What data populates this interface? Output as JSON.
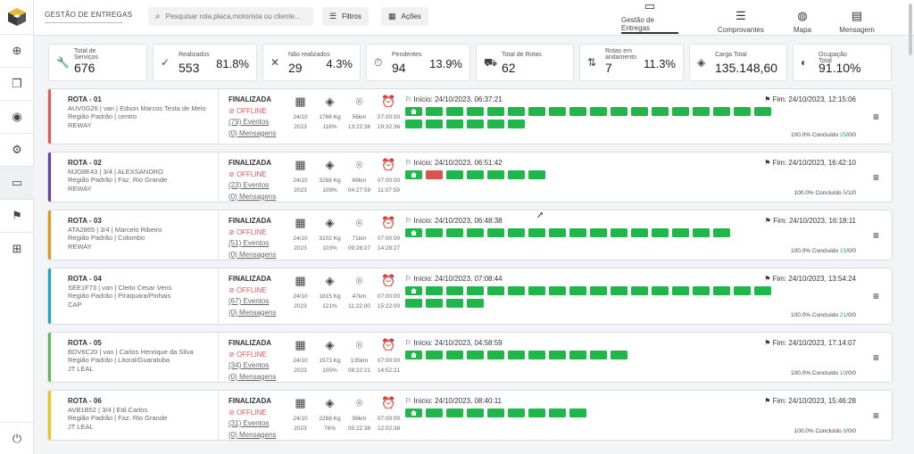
{
  "sidebar": {
    "items": [
      {
        "name": "plus-circle-icon",
        "glyph": "⊕"
      },
      {
        "name": "copy-icon",
        "glyph": "❐"
      },
      {
        "name": "user-circle-icon",
        "glyph": "◉"
      },
      {
        "name": "gear-icon",
        "glyph": "⚙"
      },
      {
        "name": "laptop-icon",
        "glyph": "▭"
      },
      {
        "name": "route-icon",
        "glyph": "⚑"
      },
      {
        "name": "sitemap-icon",
        "glyph": "⊞"
      }
    ],
    "power_glyph": "⏻"
  },
  "header": {
    "title": "GESTÃO DE ENTREGAS",
    "search_placeholder": "Pesquisar rota,placa,motorista ou cliente...",
    "filters_label": "Filtros",
    "actions_label": "Ações",
    "nav": [
      {
        "label": "Gestão de Entregas",
        "icon": "laptop-icon",
        "glyph": "▭"
      },
      {
        "label": "Comprovantes",
        "icon": "checklist-icon",
        "glyph": "☰"
      },
      {
        "label": "Mapa",
        "icon": "globe-icon",
        "glyph": "◍"
      },
      {
        "label": "Mensagem",
        "icon": "message-icon",
        "glyph": "▤"
      }
    ]
  },
  "stats": [
    {
      "label": "Total de Serviços",
      "value": "676",
      "pct": "",
      "icon": "wrench-icon",
      "glyph": "🔧",
      "w": 111
    },
    {
      "label": "Realizados",
      "value": "553",
      "pct": "81.8%",
      "icon": "check-circle-icon",
      "glyph": "✓",
      "w": 117
    },
    {
      "label": "Não realizados",
      "value": "29",
      "pct": "4.3%",
      "icon": "x-circle-icon",
      "glyph": "✕",
      "w": 110
    },
    {
      "label": "Pendentes",
      "value": "94",
      "pct": "13.9%",
      "icon": "stopwatch-icon",
      "glyph": "⏱",
      "w": 117
    },
    {
      "label": "Total de Rotas",
      "value": "62",
      "pct": "",
      "icon": "truck-icon",
      "glyph": "⛟",
      "w": 110
    },
    {
      "label": "Rotas em andamento",
      "value": "7",
      "pct": "11.3%",
      "icon": "arrows-icon",
      "glyph": "⇅",
      "w": 117
    },
    {
      "label": "Carga Total",
      "value": "135.148,60",
      "pct": "",
      "icon": "layers-icon",
      "glyph": "◈",
      "w": 110
    },
    {
      "label": "Ocupação Total",
      "value": "91.10%",
      "pct": "",
      "icon": "gauge-icon",
      "glyph": "◐",
      "w": 111
    }
  ],
  "routes": [
    {
      "name": "ROTA - 01",
      "vehicle": "AUV0G26 | van | Edson Marcos Testa de Melo",
      "region": "Região Padrão | centro",
      "company": "REWAY",
      "color": "#e05a5a",
      "status": "FINALIZADA",
      "offline": "OFFLINE",
      "events": "(79) Eventos",
      "messages": "(0) Mensagens",
      "date": "24/10",
      "year": "2023",
      "weight": "1766 Kg",
      "occupancy": "118%",
      "distance": "56km",
      "time": "13:22:36",
      "window": "07:00:00",
      "window2": "19:32:36",
      "start": "Início: 24/10/2023, 06:37:21",
      "end": "Fim: 24/10/2023, 12:15:06",
      "chips": [
        "home",
        "g",
        "g",
        "g",
        "g",
        "g",
        "g",
        "g",
        "g",
        "g",
        "g",
        "g",
        "g",
        "g",
        "g",
        "g",
        "g",
        "g",
        "g",
        "g",
        "g",
        "g",
        "g",
        "g"
      ],
      "summary_prefix": "100.0% Concluído ",
      "done": "25",
      "tail": "/0/0",
      "height": 63
    },
    {
      "name": "ROTA - 02",
      "vehicle": "MJO8E43 | 3/4 | ALEXSANDRO",
      "region": "Região Padrão | Faz. Rio Grande",
      "company": "REWAY",
      "color": "#6a3db8",
      "status": "FINALIZADA",
      "offline": "OFFLINE",
      "events": "(23) Eventos",
      "messages": "(0) Mensagens",
      "date": "24/10",
      "year": "2023",
      "weight": "3268 Kg",
      "occupancy": "109%",
      "distance": "69km",
      "time": "04:27:59",
      "window": "07:00:00",
      "window2": "11:07:59",
      "start": "Início: 24/10/2023, 06:51:42",
      "end": "Fim: 24/10/2023, 16:42:10",
      "chips": [
        "home",
        "red",
        "g",
        "g",
        "g",
        "g",
        "g"
      ],
      "summary_prefix": "100.0% Concluído ",
      "done": "5",
      "tail": "/1/0",
      "height": 57
    },
    {
      "name": "ROTA - 03",
      "vehicle": "ATA2865 | 3/4 | Marcelo Ribeiro",
      "region": "Região Padrão | Colombo",
      "company": "REWAY",
      "color": "#e8951c",
      "status": "FINALIZADA",
      "offline": "OFFLINE",
      "events": "(51) Eventos",
      "messages": "(0) Mensagens",
      "date": "24/10",
      "year": "2023",
      "weight": "3102 Kg",
      "occupancy": "103%",
      "distance": "71km",
      "time": "09:28:27",
      "window": "07:00:00",
      "window2": "14:28:27",
      "start": "Início: 24/10/2023, 06:48:38",
      "end": "Fim: 24/10/2023, 16:18:11",
      "chips": [
        "home",
        "g",
        "g",
        "g",
        "g",
        "g",
        "g",
        "g",
        "g",
        "g",
        "g",
        "g",
        "g",
        "g",
        "g",
        "g"
      ],
      "summary_prefix": "100.0% Concluído ",
      "done": "15",
      "tail": "/0/0",
      "height": 57
    },
    {
      "name": "ROTA - 04",
      "vehicle": "SEE1F73 | van | Cleito Cesar Vens",
      "region": "Região Padrão | Piraquara/Pinhais",
      "company": "CAP",
      "color": "#1aa7c4",
      "status": "FINALIZADA",
      "offline": "OFFLINE",
      "events": "(67) Eventos",
      "messages": "(0) Mensagens",
      "date": "24/10",
      "year": "2023",
      "weight": "1815 Kg",
      "occupancy": "121%",
      "distance": "47km",
      "time": "11:22:00",
      "window": "07:00:00",
      "window2": "15:22:00",
      "start": "Início: 24/10/2023, 07:08:44",
      "end": "Fim: 24/10/2023, 13:54:24",
      "chips": [
        "home",
        "g",
        "g",
        "g",
        "g",
        "g",
        "g",
        "g",
        "g",
        "g",
        "g",
        "g",
        "g",
        "g",
        "g",
        "g",
        "g",
        "g",
        "g",
        "g",
        "g",
        "g"
      ],
      "summary_prefix": "100.0% Concluído ",
      "done": "21",
      "tail": "/0/0",
      "height": 64
    },
    {
      "name": "ROTA - 05",
      "vehicle": "BDV6C20 | van | Carlos Henrique da Silva",
      "region": "Região Padrão | Litoral/Guaratuba",
      "company": "JT LEAL",
      "color": "#5cb85c",
      "status": "FINALIZADA",
      "offline": "OFFLINE",
      "events": "(34) Eventos",
      "messages": "(0) Mensagens",
      "date": "24/10",
      "year": "2023",
      "weight": "1573 Kg",
      "occupancy": "105%",
      "distance": "135km",
      "time": "08:22:21",
      "window": "07:00:00",
      "window2": "14:52:21",
      "start": "Início: 24/10/2023, 04:58:59",
      "end": "Fim: 24/10/2023, 17:14:07",
      "chips": [
        "home",
        "g",
        "g",
        "g",
        "g",
        "g",
        "g",
        "g",
        "g",
        "g",
        "g"
      ],
      "summary_prefix": "100.0% Concluído ",
      "done": "10",
      "tail": "/0/0",
      "height": 57
    },
    {
      "name": "ROTA - 06",
      "vehicle": "AVB1B52 | 3/4 | Edi Carlos",
      "region": "Região Padrão | Faz. Rio Grande",
      "company": "JT LEAL",
      "color": "#f0c419",
      "status": "FINALIZADA",
      "offline": "OFFLINE",
      "events": "(31) Eventos",
      "messages": "(0) Mensagens",
      "date": "24/10",
      "year": "2023",
      "weight": "2268 Kg",
      "occupancy": "76%",
      "distance": "99km",
      "time": "05:22:38",
      "window": "07:00:00",
      "window2": "12:02:38",
      "start": "Início: 24/10/2023, 08:40:11",
      "end": "Fim: 24/10/2023, 15:46:28",
      "chips": [
        "home",
        "g",
        "g",
        "g",
        "g",
        "g",
        "g",
        "g",
        "g"
      ],
      "summary_prefix": "100.0% Concluído ",
      "done": "8",
      "tail": "/0/0",
      "height": 57
    }
  ]
}
